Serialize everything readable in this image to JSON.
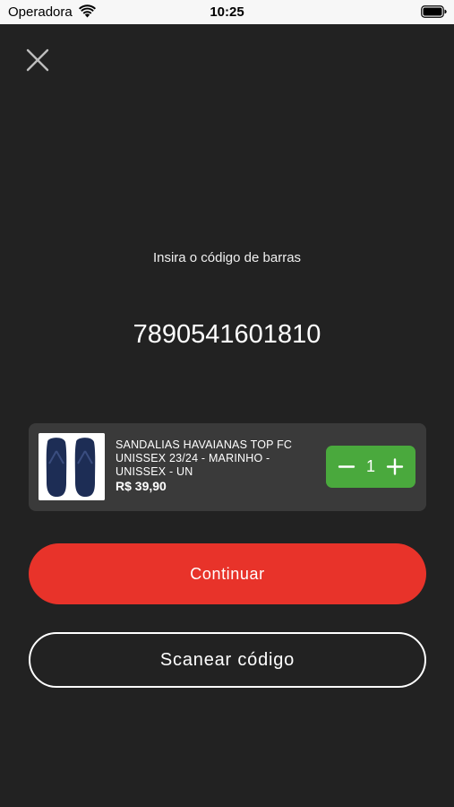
{
  "status_bar": {
    "carrier": "Operadora",
    "time": "10:25"
  },
  "screen": {
    "prompt": "Insira o código de barras",
    "barcode_value": "7890541601810"
  },
  "product": {
    "name": "SANDALIAS HAVAIANAS TOP FC UNISSEX 23/24 - MARINHO - UNISSEX - UN",
    "price": "R$ 39,90",
    "quantity": "1",
    "image_icon": "flip-flop-sandals-image"
  },
  "buttons": {
    "continue_label": "Continuar",
    "scan_label": "Scanear código"
  },
  "colors": {
    "background": "#222222",
    "card": "#3a3a3a",
    "accent_red": "#e8332a",
    "stepper_green": "#4aa93d"
  }
}
